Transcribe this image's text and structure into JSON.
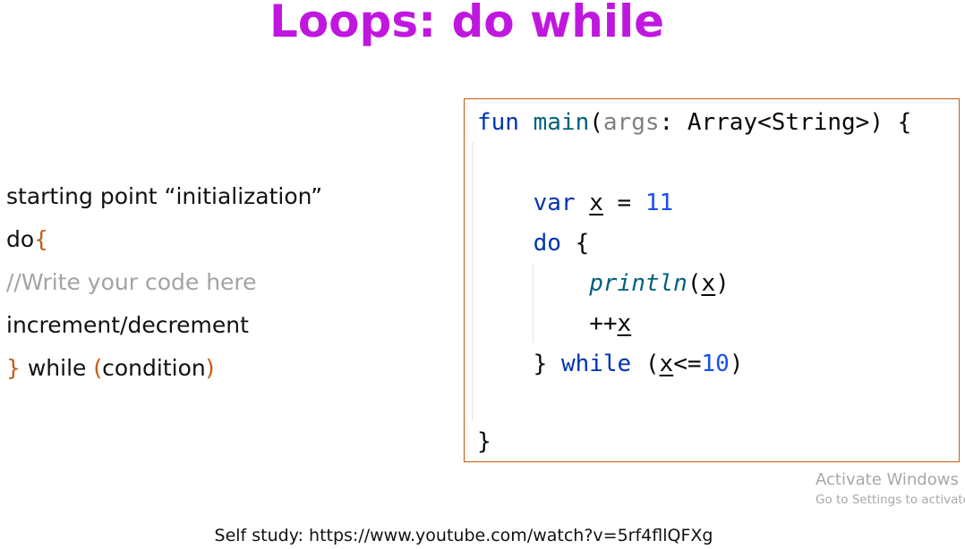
{
  "slide": {
    "title": "Loops: do while",
    "pseudocode": {
      "line1": "starting point “initialization”",
      "line2_kw": "do",
      "line2_brace": "{",
      "line3": "//Write your code here",
      "line4": "increment/decrement",
      "line5_brace": "}",
      "line5_kw": " while ",
      "line5_open": "(",
      "line5_cond": "condition",
      "line5_close": ")"
    },
    "code": {
      "l1_fun": "fun",
      "l1_main": "main",
      "l1_open": "(",
      "l1_args": "args",
      "l1_rest": ": Array<String>) {",
      "l3_var": "var",
      "l3_x": "x",
      "l3_eq": " = ",
      "l3_num": "11",
      "l4_do": "do",
      "l4_brace": " {",
      "l5_println": "println",
      "l5_open": "(",
      "l5_x": "x",
      "l5_close": ")",
      "l6_inc": "++",
      "l6_x": "x",
      "l7_brace": "} ",
      "l7_while": "while",
      "l7_open": " (",
      "l7_x": "x",
      "l7_op": "<=",
      "l7_num": "10",
      "l7_close": ")",
      "l9_brace": "}"
    },
    "watermark": {
      "line1": "Activate Windows",
      "line2": "Go to Settings to activate"
    },
    "footer": "Self study: https://www.youtube.com/watch?v=5rf4fllQFXg"
  },
  "colors": {
    "title": "#c017e0",
    "accent_orange": "#c55a11",
    "comment_gray": "#a3a3a3",
    "keyword_blue": "#0033b3",
    "function_teal": "#00627a",
    "number_blue": "#1750eb"
  }
}
